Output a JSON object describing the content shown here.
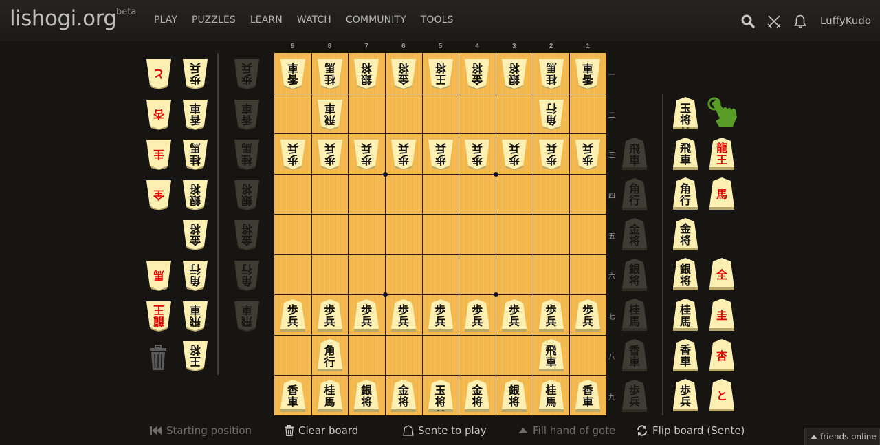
{
  "header": {
    "logo": "lishogi.org",
    "beta": "beta",
    "nav": [
      "PLAY",
      "PUZZLES",
      "LEARN",
      "WATCH",
      "COMMUNITY",
      "TOOLS"
    ],
    "icons": [
      "search-icon",
      "crossed-swords-icon",
      "bell-icon"
    ],
    "username": "LuffyKudo"
  },
  "board": {
    "files": [
      "9",
      "8",
      "7",
      "6",
      "5",
      "4",
      "3",
      "2",
      "1"
    ],
    "ranks": [
      "一",
      "二",
      "三",
      "四",
      "五",
      "六",
      "七",
      "八",
      "九"
    ],
    "colors": {
      "wood": "#f5bc55",
      "line": "#2a1e0a",
      "piece_face": "#fdf0b2",
      "piece_edge": "#b8a96a",
      "promoted_text": "#e10000"
    },
    "pieces": [
      {
        "file": 9,
        "rank": 1,
        "top": "香",
        "bottom": "車",
        "side": "gote"
      },
      {
        "file": 8,
        "rank": 1,
        "top": "桂",
        "bottom": "馬",
        "side": "gote"
      },
      {
        "file": 7,
        "rank": 1,
        "top": "銀",
        "bottom": "将",
        "side": "gote"
      },
      {
        "file": 6,
        "rank": 1,
        "top": "金",
        "bottom": "将",
        "side": "gote"
      },
      {
        "file": 5,
        "rank": 1,
        "top": "王",
        "bottom": "将",
        "side": "gote"
      },
      {
        "file": 4,
        "rank": 1,
        "top": "金",
        "bottom": "将",
        "side": "gote"
      },
      {
        "file": 3,
        "rank": 1,
        "top": "銀",
        "bottom": "将",
        "side": "gote"
      },
      {
        "file": 2,
        "rank": 1,
        "top": "桂",
        "bottom": "馬",
        "side": "gote"
      },
      {
        "file": 1,
        "rank": 1,
        "top": "香",
        "bottom": "車",
        "side": "gote"
      },
      {
        "file": 8,
        "rank": 2,
        "top": "飛",
        "bottom": "車",
        "side": "gote"
      },
      {
        "file": 2,
        "rank": 2,
        "top": "角",
        "bottom": "行",
        "side": "gote"
      },
      {
        "file": 9,
        "rank": 3,
        "top": "歩",
        "bottom": "兵",
        "side": "gote"
      },
      {
        "file": 8,
        "rank": 3,
        "top": "歩",
        "bottom": "兵",
        "side": "gote"
      },
      {
        "file": 7,
        "rank": 3,
        "top": "歩",
        "bottom": "兵",
        "side": "gote"
      },
      {
        "file": 6,
        "rank": 3,
        "top": "歩",
        "bottom": "兵",
        "side": "gote"
      },
      {
        "file": 5,
        "rank": 3,
        "top": "歩",
        "bottom": "兵",
        "side": "gote"
      },
      {
        "file": 4,
        "rank": 3,
        "top": "歩",
        "bottom": "兵",
        "side": "gote"
      },
      {
        "file": 3,
        "rank": 3,
        "top": "歩",
        "bottom": "兵",
        "side": "gote"
      },
      {
        "file": 2,
        "rank": 3,
        "top": "歩",
        "bottom": "兵",
        "side": "gote"
      },
      {
        "file": 1,
        "rank": 3,
        "top": "歩",
        "bottom": "兵",
        "side": "gote"
      },
      {
        "file": 9,
        "rank": 7,
        "top": "歩",
        "bottom": "兵",
        "side": "sente"
      },
      {
        "file": 8,
        "rank": 7,
        "top": "歩",
        "bottom": "兵",
        "side": "sente"
      },
      {
        "file": 7,
        "rank": 7,
        "top": "歩",
        "bottom": "兵",
        "side": "sente"
      },
      {
        "file": 6,
        "rank": 7,
        "top": "歩",
        "bottom": "兵",
        "side": "sente"
      },
      {
        "file": 5,
        "rank": 7,
        "top": "歩",
        "bottom": "兵",
        "side": "sente"
      },
      {
        "file": 4,
        "rank": 7,
        "top": "歩",
        "bottom": "兵",
        "side": "sente"
      },
      {
        "file": 3,
        "rank": 7,
        "top": "歩",
        "bottom": "兵",
        "side": "sente"
      },
      {
        "file": 2,
        "rank": 7,
        "top": "歩",
        "bottom": "兵",
        "side": "sente"
      },
      {
        "file": 1,
        "rank": 7,
        "top": "歩",
        "bottom": "兵",
        "side": "sente"
      },
      {
        "file": 8,
        "rank": 8,
        "top": "角",
        "bottom": "行",
        "side": "sente"
      },
      {
        "file": 2,
        "rank": 8,
        "top": "飛",
        "bottom": "車",
        "side": "sente"
      },
      {
        "file": 9,
        "rank": 9,
        "top": "香",
        "bottom": "車",
        "side": "sente"
      },
      {
        "file": 8,
        "rank": 9,
        "top": "桂",
        "bottom": "馬",
        "side": "sente"
      },
      {
        "file": 7,
        "rank": 9,
        "top": "銀",
        "bottom": "将",
        "side": "sente"
      },
      {
        "file": 6,
        "rank": 9,
        "top": "金",
        "bottom": "将",
        "side": "sente"
      },
      {
        "file": 5,
        "rank": 9,
        "top": "玉",
        "bottom": "将",
        "side": "sente"
      },
      {
        "file": 4,
        "rank": 9,
        "top": "金",
        "bottom": "将",
        "side": "sente"
      },
      {
        "file": 3,
        "rank": 9,
        "top": "銀",
        "bottom": "将",
        "side": "sente"
      },
      {
        "file": 2,
        "rank": 9,
        "top": "桂",
        "bottom": "馬",
        "side": "sente"
      },
      {
        "file": 1,
        "rank": 9,
        "top": "香",
        "bottom": "車",
        "side": "sente"
      }
    ]
  },
  "gote_spare": {
    "promoted": [
      {
        "top": "と",
        "bottom": ""
      },
      {
        "top": "杏",
        "bottom": ""
      },
      {
        "top": "圭",
        "bottom": ""
      },
      {
        "top": "全",
        "bottom": ""
      },
      null,
      {
        "top": "馬",
        "bottom": ""
      },
      {
        "top": "龍",
        "bottom": "王"
      },
      null
    ],
    "unpromoted": [
      {
        "top": "歩",
        "bottom": "兵"
      },
      {
        "top": "香",
        "bottom": "車"
      },
      {
        "top": "桂",
        "bottom": "馬"
      },
      {
        "top": "銀",
        "bottom": "将"
      },
      {
        "top": "金",
        "bottom": "将"
      },
      {
        "top": "角",
        "bottom": "行"
      },
      {
        "top": "飛",
        "bottom": "車"
      },
      {
        "top": "王",
        "bottom": "将"
      }
    ],
    "hand": [
      {
        "top": "歩",
        "bottom": "兵"
      },
      {
        "top": "香",
        "bottom": "車"
      },
      {
        "top": "桂",
        "bottom": "馬"
      },
      {
        "top": "銀",
        "bottom": "将"
      },
      {
        "top": "金",
        "bottom": "将"
      },
      {
        "top": "角",
        "bottom": "行"
      },
      {
        "top": "飛",
        "bottom": "車"
      }
    ]
  },
  "sente_spare": {
    "unpromoted": [
      {
        "top": "玉",
        "bottom": "将"
      },
      {
        "top": "飛",
        "bottom": "車"
      },
      {
        "top": "角",
        "bottom": "行"
      },
      {
        "top": "金",
        "bottom": "将"
      },
      {
        "top": "銀",
        "bottom": "将"
      },
      {
        "top": "桂",
        "bottom": "馬"
      },
      {
        "top": "香",
        "bottom": "車"
      },
      {
        "top": "歩",
        "bottom": "兵"
      }
    ],
    "promoted": [
      null,
      {
        "top": "龍",
        "bottom": "王"
      },
      {
        "top": "馬",
        "bottom": ""
      },
      null,
      {
        "top": "全",
        "bottom": ""
      },
      {
        "top": "圭",
        "bottom": ""
      },
      {
        "top": "杏",
        "bottom": ""
      },
      {
        "top": "と",
        "bottom": ""
      }
    ],
    "hand": [
      {
        "top": "飛",
        "bottom": "車"
      },
      {
        "top": "角",
        "bottom": "行"
      },
      {
        "top": "金",
        "bottom": "将"
      },
      {
        "top": "銀",
        "bottom": "将"
      },
      {
        "top": "桂",
        "bottom": "馬"
      },
      {
        "top": "香",
        "bottom": "車"
      },
      {
        "top": "歩",
        "bottom": "兵"
      }
    ],
    "pointer_icon": "hand-pointer-icon"
  },
  "controls": {
    "starting_position": "Starting position",
    "clear_board": "Clear board",
    "sente_to_play": "Sente to play",
    "fill_hand": "Fill hand of gote",
    "flip_board": "Flip board (Sente)"
  },
  "friends": "friends online"
}
